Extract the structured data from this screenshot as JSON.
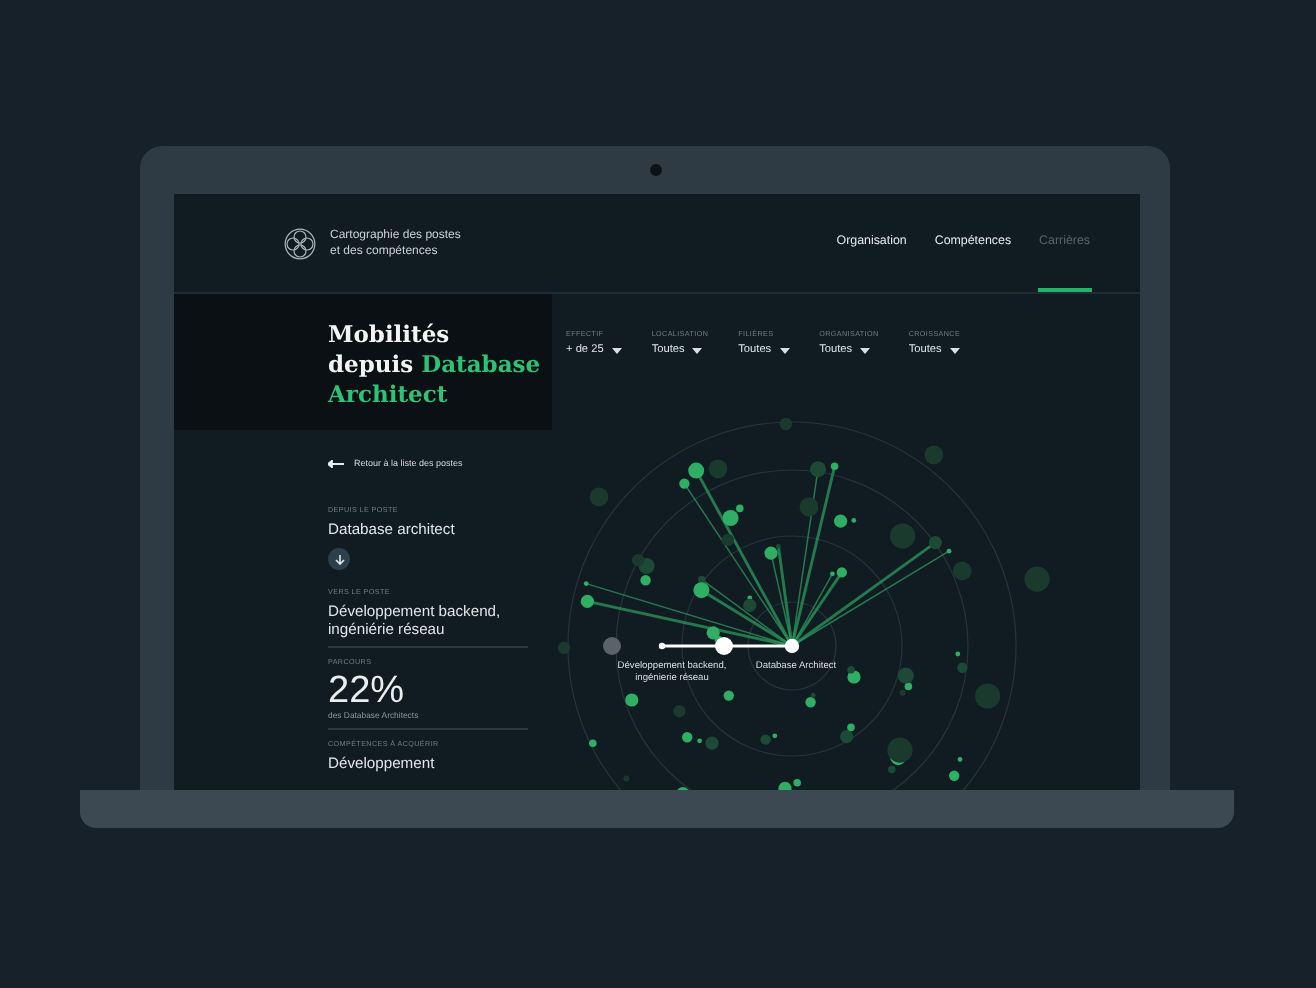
{
  "header": {
    "title_line_1": "Cartographie des postes",
    "title_line_2": "et des compétences"
  },
  "nav": [
    {
      "label": "Organisation",
      "selected": false
    },
    {
      "label": "Compétences",
      "selected": false
    },
    {
      "label": "Carrières",
      "selected": true
    }
  ],
  "hero": {
    "line_1": "Mobilités",
    "line_2_prefix": "depuis",
    "highlight_1": "Database",
    "highlight_2": "Architect"
  },
  "filters": [
    {
      "label": "EFFECTIF",
      "value": "+ de 25"
    },
    {
      "label": "LOCALISATION",
      "value": "Toutes"
    },
    {
      "label": "FILIÈRES",
      "value": "Toutes"
    },
    {
      "label": "ORGANISATION",
      "value": "Toutes"
    },
    {
      "label": "CROISSANCE",
      "value": "Toutes"
    }
  ],
  "back_link": "Retour à la liste des postes",
  "sections": [
    {
      "kind": "from",
      "label": "DEPUIS LE POSTE",
      "value": "Database architect"
    },
    {
      "kind": "to",
      "label": "VERS LE POSTE",
      "value": "Développement backend, ingéniérie réseau"
    },
    {
      "kind": "stat",
      "label": "PARCOURS",
      "value": "22%",
      "note": "des Database Architects"
    },
    {
      "kind": "skills",
      "label": "COMPÉTENCES À ACQUÉRIR",
      "value": "Développement"
    }
  ],
  "graph": {
    "target_label": "Développement backend, ingénierie réseau",
    "source_label": "Database Architect"
  }
}
